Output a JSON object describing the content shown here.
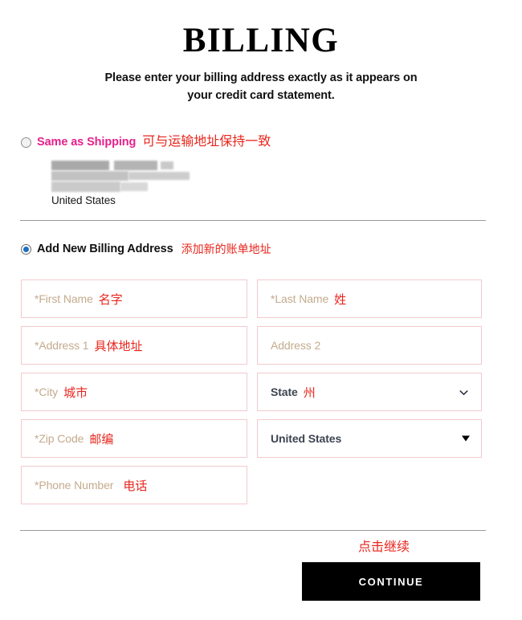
{
  "header": {
    "title": "BILLING",
    "subtitle": "Please enter your billing address exactly as it appears on your credit card statement."
  },
  "options": {
    "same_as_shipping": {
      "label": "Same as Shipping",
      "note_cn": "可与运输地址保持一致",
      "selected": false,
      "address_country": "United States"
    },
    "add_new": {
      "label": "Add New Billing Address",
      "note_cn": "添加新的账单地址",
      "selected": true
    }
  },
  "form": {
    "first_name": {
      "placeholder": "*First Name",
      "note_cn": "名字",
      "value": ""
    },
    "last_name": {
      "placeholder": "*Last Name",
      "note_cn": "姓",
      "value": ""
    },
    "address1": {
      "placeholder": "*Address 1",
      "note_cn": "具体地址",
      "value": ""
    },
    "address2": {
      "placeholder": "Address 2",
      "note_cn": "",
      "value": ""
    },
    "city": {
      "placeholder": "*City",
      "note_cn": "城市",
      "value": ""
    },
    "state": {
      "placeholder": "State",
      "note_cn": "州",
      "value": ""
    },
    "zip": {
      "placeholder": "*Zip Code",
      "note_cn": "邮编",
      "value": ""
    },
    "country": {
      "value": "United States",
      "note_cn": ""
    },
    "phone": {
      "placeholder": "*Phone Number",
      "note_cn": "电话",
      "value": ""
    }
  },
  "footer": {
    "continue_note_cn": "点击继续",
    "continue_label": "CONTINUE"
  },
  "colors": {
    "accent_pink": "#e5218c",
    "annotation_red": "#e8261d",
    "field_border": "#f3c9cd",
    "placeholder": "#c4ab8d",
    "button_bg": "#000000"
  }
}
